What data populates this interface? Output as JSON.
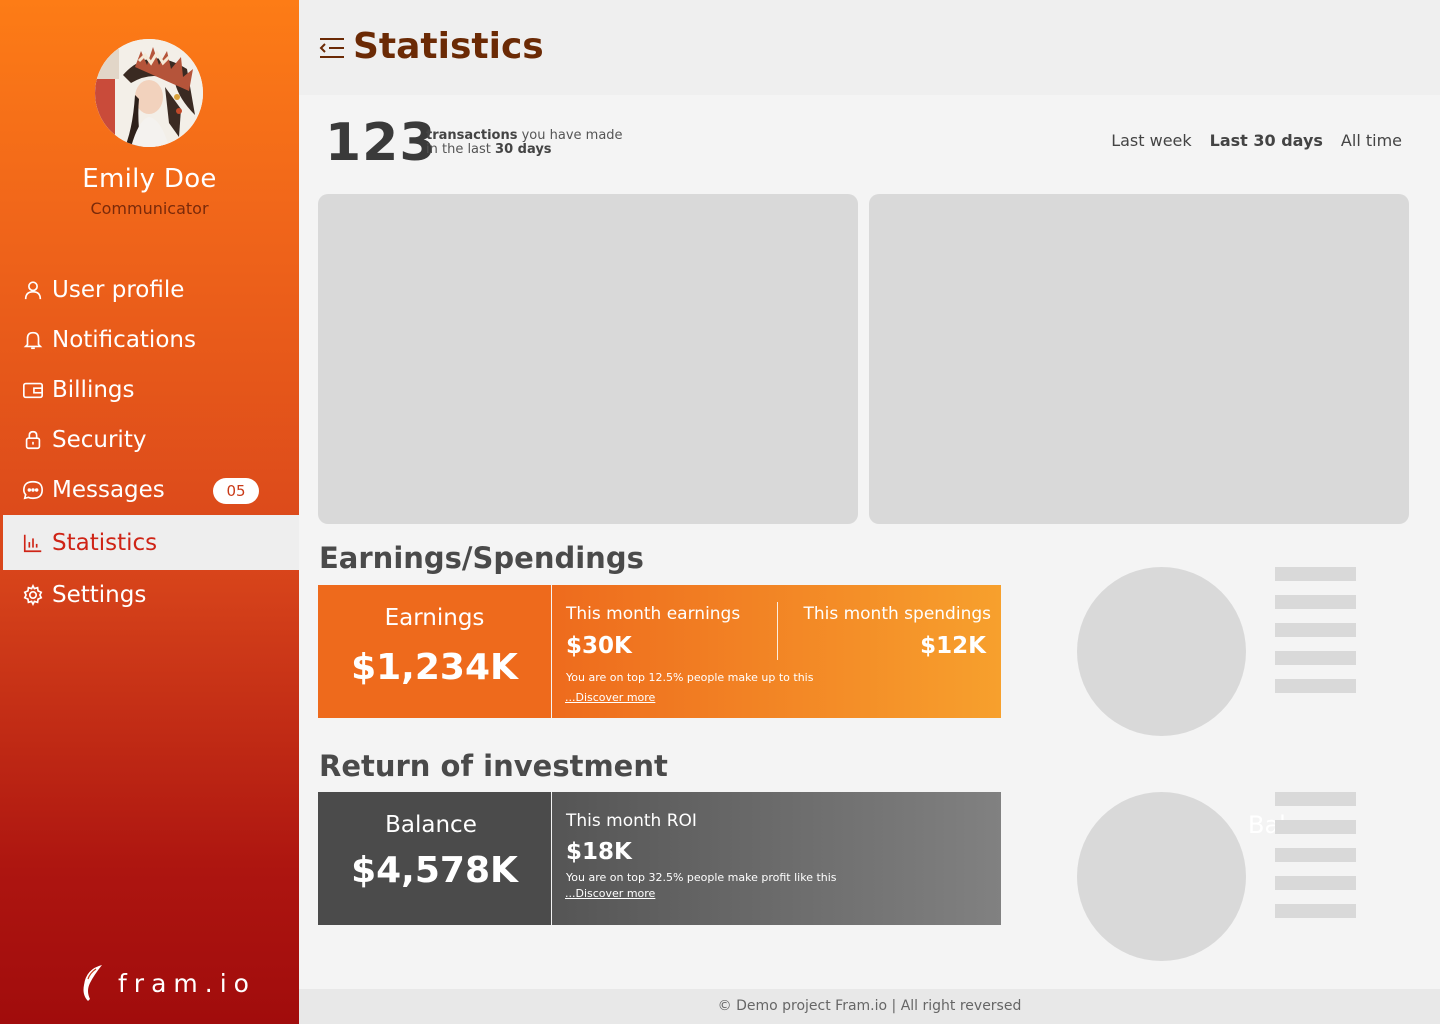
{
  "user": {
    "name": "Emily Doe",
    "role": "Communicator"
  },
  "nav": [
    {
      "label": "User profile",
      "icon": "user-icon"
    },
    {
      "label": "Notifications",
      "icon": "bell-icon"
    },
    {
      "label": "Billings",
      "icon": "wallet-icon"
    },
    {
      "label": "Security",
      "icon": "lock-icon"
    },
    {
      "label": "Messages",
      "icon": "chat-icon",
      "badge": "05"
    },
    {
      "label": "Statistics",
      "icon": "bar-chart-icon",
      "active": true
    },
    {
      "label": "Settings",
      "icon": "gear-icon"
    }
  ],
  "brand": {
    "name": "fram.io"
  },
  "header": {
    "title": "Statistics"
  },
  "summary": {
    "count": "123",
    "bold1": "transactions",
    "text1": " you have made",
    "text2": "in the last ",
    "bold2": "30 days"
  },
  "ranges": {
    "week": "Last week",
    "days30": "Last 30 days",
    "all": "All time",
    "selected": "Last 30 days"
  },
  "earnings": {
    "section_title": "Earnings/Spendings",
    "label": "Earnings",
    "value": "$1,234K",
    "month_earnings_label": "This month earnings",
    "month_earnings_value": "$30K",
    "month_spendings_label": "This month spendings",
    "month_spendings_value": "$12K",
    "note": "You are on top 12.5% people make up  to this",
    "link": "...Discover more"
  },
  "roi": {
    "section_title": "Return of investment",
    "label": "Balance",
    "value": "$4,578K",
    "month_label": "This month ROI",
    "month_value": "$18K",
    "note": "You are on top 32.5% people make profit like this",
    "link": "...Discover more"
  },
  "ghost_text": "Bal",
  "footer": "© Demo project Fram.io | All right reversed",
  "colors": {
    "accent": "#fd7c16",
    "sidebar_bottom": "#a10c0c",
    "active_text": "#cf2416",
    "title": "#6b2a05"
  }
}
